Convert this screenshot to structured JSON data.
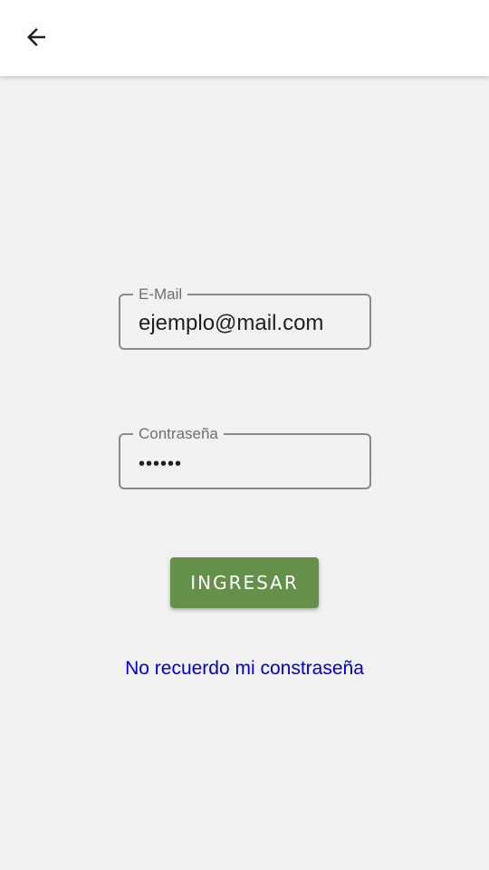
{
  "header": {
    "back_icon": "arrow-left-icon"
  },
  "form": {
    "email": {
      "label": "E-Mail",
      "value": "ejemplo@mail.com"
    },
    "password": {
      "label": "Contraseña",
      "value": "••••••"
    },
    "submit_label": "INGRESAR",
    "forgot_label": "No recuerdo mi constraseña"
  },
  "colors": {
    "background": "#f1f1f1",
    "button": "#64904a",
    "link": "#0000d0"
  }
}
